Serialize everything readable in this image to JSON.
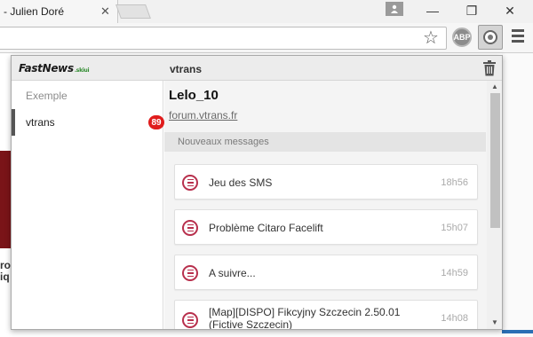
{
  "browser": {
    "tab_title": "- Julien Doré",
    "tab_close": "✕",
    "window_controls": {
      "minimize": "—",
      "restore": "❐",
      "close": "✕"
    },
    "toolbar_icons": [
      "star-icon",
      "abp-icon",
      "extension-icon",
      "menu-icon"
    ],
    "abp_label": "ABP"
  },
  "page_behind": {
    "text_line1": "ro",
    "text_line2": "iq"
  },
  "popup": {
    "logo": {
      "main": "FastNews",
      "suffix": ".skiui"
    },
    "header_title": "vtrans",
    "sidebar": {
      "items": [
        {
          "label": "Exemple",
          "active": false
        },
        {
          "label": "vtrans",
          "active": true,
          "badge": "89"
        }
      ]
    },
    "channel": {
      "title": "Lelo_10",
      "link": "forum.vtrans.fr",
      "section_label": "Nouveaux messages",
      "messages": [
        {
          "title": "Jeu des SMS",
          "time": "18h56"
        },
        {
          "title": "Problème Citaro Facelift",
          "time": "15h07"
        },
        {
          "title": "A suivre...",
          "time": "14h59"
        },
        {
          "title": "[Map][DISPO] Fikcyjny Szczecin 2.50.01 (Fictive Szczecin)",
          "time": "14h08"
        }
      ]
    },
    "scrollbar": {
      "up": "▲",
      "down": "▼"
    }
  },
  "colors": {
    "badge": "#e01c1c",
    "message_icon": "#b8304d",
    "logo_suffix": "#2e8b2e"
  }
}
